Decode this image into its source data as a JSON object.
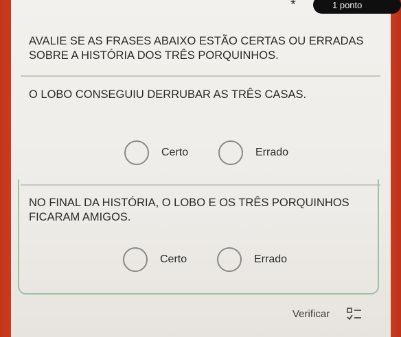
{
  "header": {
    "required_marker": "*",
    "points": "1 ponto"
  },
  "instruction": "AVALIE SE AS FRASES ABAIXO ESTÃO CERTAS OU ERRADAS SOBRE A HISTÓRIA DOS TRÊS PORQUINHOS.",
  "questions": [
    {
      "text": "O LOBO CONSEGUIU DERRUBAR AS TRÊS CASAS.",
      "options": [
        "Certo",
        "Errado"
      ]
    },
    {
      "text": "NO FINAL DA HISTÓRIA, O LOBO E OS TRÊS PORQUINHOS FICARAM AMIGOS.",
      "options": [
        "Certo",
        "Errado"
      ]
    }
  ],
  "footer": {
    "verify_label": "Verificar",
    "icon": "check-list-icon"
  },
  "colors": {
    "frame": "#d6401f",
    "card_border": "#9cc2a2",
    "text": "#2b2b2b"
  }
}
